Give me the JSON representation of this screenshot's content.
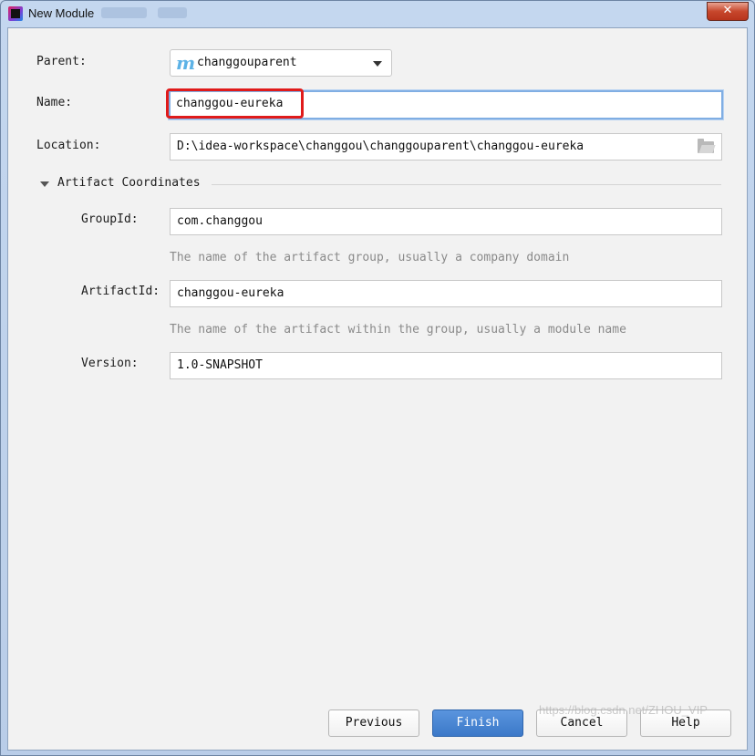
{
  "window": {
    "title": "New Module",
    "close_glyph": "✕"
  },
  "form": {
    "parent": {
      "label": "Parent:",
      "value": "changgouparent",
      "icon": "maven-m-icon"
    },
    "name": {
      "label": "Name:",
      "value": "changgou-eureka"
    },
    "location": {
      "label": "Location:",
      "value": "D:\\idea-workspace\\changgou\\changgouparent\\changgou-eureka"
    }
  },
  "artifact": {
    "section_title": "Artifact Coordinates",
    "group_id": {
      "label": "GroupId:",
      "value": "com.changgou",
      "hint": "The name of the artifact group, usually a company domain"
    },
    "artifact_id": {
      "label": "ArtifactId:",
      "value": "changgou-eureka",
      "hint": "The name of the artifact within the group, usually a module name"
    },
    "version": {
      "label": "Version:",
      "value": "1.0-SNAPSHOT"
    }
  },
  "buttons": {
    "previous": "Previous",
    "finish": "Finish",
    "cancel": "Cancel",
    "help": "Help"
  },
  "watermark": "https://blog.csdn.net/ZHOU_VIP",
  "colors": {
    "highlight": "#e01b1b",
    "primary_button": "#4a87d4",
    "focus_border": "#80aee3"
  }
}
